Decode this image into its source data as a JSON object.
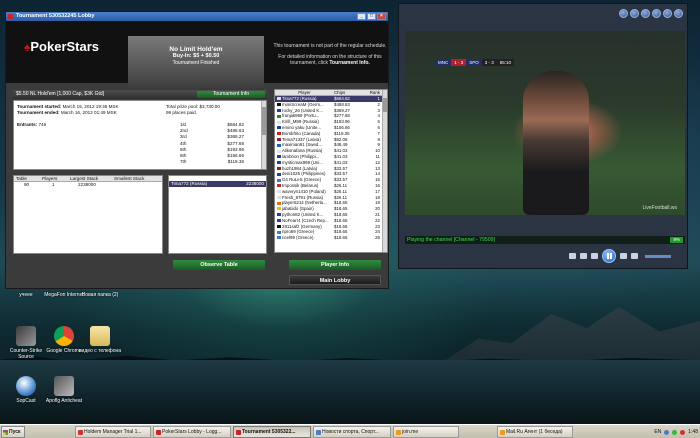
{
  "poker": {
    "window_title": "Tournament 530532245 Lobby",
    "brand": "PokerStars",
    "game_title": "No Limit Hold'em",
    "buy_in": "Buy-In: $5 + $0.50",
    "status": "Tournament Finished",
    "info_text_1": "This tournament is not part of the regular schedule.",
    "info_text_2": "For detailed information on the structure of this tournament, click",
    "info_link": "Tournament Info.",
    "tournament_name": "$5.50 NL Hold'em [1,000 Cap, $3K Gtd]",
    "tournament_info_button": "Tournament Info",
    "started_label": "Tournament started:",
    "started_value": "March 15, 2012 19:45 MSK",
    "ended_label": "Tournament ended:",
    "ended_value": "March 16, 2012 01:49 MSK",
    "entrants_label": "Entrants:",
    "entrants_value": "746",
    "prize_pool": "Total prize pool: $3,730.00",
    "places_paid": "99 places paid.",
    "prizes": [
      {
        "place": "1st",
        "amount": "$684.82"
      },
      {
        "place": "2nd",
        "amount": "$488.63"
      },
      {
        "place": "3rd",
        "amount": "$369.27"
      },
      {
        "place": "4th",
        "amount": "$277.68"
      },
      {
        "place": "5th",
        "amount": "$193.96"
      },
      {
        "place": "6th",
        "amount": "$156.66"
      },
      {
        "place": "7th",
        "amount": "$119.36"
      }
    ],
    "table_headers": [
      "Table",
      "Players",
      "Largest Stack",
      "Smallest Stack"
    ],
    "table_rows": [
      [
        "90",
        "1",
        "2238000",
        ""
      ]
    ],
    "selected_player": {
      "name": "Tima772 (Russia)",
      "stack": "2238000"
    },
    "player_headers": [
      "Player",
      "Chips",
      "Rank"
    ],
    "players": [
      {
        "name": "Tima772 (Russia)",
        "chips": "$684.82",
        "rank": "1",
        "flag": "#e0e0e0"
      },
      {
        "name": "mimiScreaM (Germ...",
        "chips": "$488.63",
        "rank": "2",
        "flag": "#111111"
      },
      {
        "name": "rocky_26 (United K...",
        "chips": "$369.27",
        "rank": "3",
        "flag": "#2040a0"
      },
      {
        "name": "franjak969 (Portu...",
        "chips": "$277.68",
        "rank": "4",
        "flag": "#2a8a2a"
      },
      {
        "name": "Kirill_M99 (Russia)",
        "chips": "$193.96",
        "rank": "5",
        "flag": "#e0e0e0"
      },
      {
        "name": "emino yaku (Unite...",
        "chips": "$156.66",
        "rank": "6",
        "flag": "#2040a0"
      },
      {
        "name": "Bombfrito (Canada)",
        "chips": "$119.36",
        "rank": "7",
        "flag": "#d02020"
      },
      {
        "name": "Tema71337 (Latvia)",
        "chips": "$82.06",
        "rank": "8",
        "flag": "#8a2030"
      },
      {
        "name": "maximan91 (Swed...",
        "chips": "$48.49",
        "rank": "9",
        "flag": "#2060c0"
      },
      {
        "name": "Aliksnafana (Russia)",
        "chips": "$41.03",
        "rank": "10",
        "flag": "#e0e0e0"
      },
      {
        "name": "lambrion (Philippi...",
        "chips": "$41.03",
        "rank": "11",
        "flag": "#2040a0"
      },
      {
        "name": "mysticmax999 (Uni...",
        "chips": "$41.03",
        "rank": "12",
        "flag": "#2040a0"
      },
      {
        "name": "buzh1984 (Latvia)",
        "chips": "$33.57",
        "rank": "13",
        "flag": "#8a2030"
      },
      {
        "name": "deni1025 (Philippines)",
        "chips": "$33.57",
        "rank": "14",
        "flag": "#2040a0"
      },
      {
        "name": "G4 RuLeS (Greece)",
        "chips": "$33.57",
        "rank": "15",
        "flag": "#3a7ad0"
      },
      {
        "name": "Impossik (Belarus)",
        "chips": "$26.11",
        "rank": "16",
        "flag": "#c03030"
      },
      {
        "name": "wavvryn1410 (Poland)",
        "chips": "$26.11",
        "rank": "17",
        "flag": "#e0e0e0"
      },
      {
        "name": "Fresh_8791 (Russia)",
        "chips": "$26.11",
        "rank": "18",
        "flag": "#e0e0e0"
      },
      {
        "name": "player6214 (Netherla...",
        "chips": "$18.65",
        "rank": "19",
        "flag": "#e07020"
      },
      {
        "name": "jabatiido (Spain)",
        "chips": "$18.65",
        "rank": "20",
        "flag": "#e0c020"
      },
      {
        "name": "python82 (United K...",
        "chips": "$18.65",
        "rank": "21",
        "flag": "#2040a0"
      },
      {
        "name": "NoFearr4 (Czech Rep...",
        "chips": "$18.65",
        "rank": "22",
        "flag": "#2040a0"
      },
      {
        "name": "2811safz (Germany)",
        "chips": "$18.65",
        "rank": "23",
        "flag": "#111111"
      },
      {
        "name": "ripro69 (Greece)",
        "chips": "$18.65",
        "rank": "24",
        "flag": "#3a7ad0"
      },
      {
        "name": "ricel99 (Greece)",
        "chips": "$18.65",
        "rank": "25",
        "flag": "#3a7ad0"
      }
    ],
    "observe_button": "Observe Table",
    "player_info_button": "Player Info",
    "main_lobby_button": "Main Lobby"
  },
  "player_window": {
    "score": {
      "home": "MNC",
      "score": "1 - 3",
      "away": "SPO",
      "time": "85:10",
      "agg": "3 - 3"
    },
    "watermark": "LiveFootball.ws",
    "status": "Playing the channel [Channel - 79509]",
    "badge": "9%"
  },
  "desktop": {
    "icons": [
      {
        "label": "учеее"
      },
      {
        "label": "MegaFon Internet"
      },
      {
        "label": "Новая папка (2)"
      },
      {
        "label": "Counter-Strike Source"
      },
      {
        "label": "Google Chrome"
      },
      {
        "label": "видео с телефона"
      },
      {
        "label": "SopCast"
      },
      {
        "label": "Apoflg Anticheat"
      }
    ]
  },
  "taskbar": {
    "start": "Пуск",
    "items": [
      "Holdem Manager Trial 1...",
      "PokerStars Lobby - Logg...",
      "Tournament 5305322...",
      "Новости спорта, Спорт...",
      "join.me",
      "Mail.Ru Агент (1 беседа)"
    ],
    "lang": "EN",
    "clock": "1:48"
  },
  "colors": {
    "pokerstars_red": "#c0141c",
    "green_button": "#2f8d3e",
    "selection": "#3a3a6a",
    "status_green": "#34e04a"
  }
}
